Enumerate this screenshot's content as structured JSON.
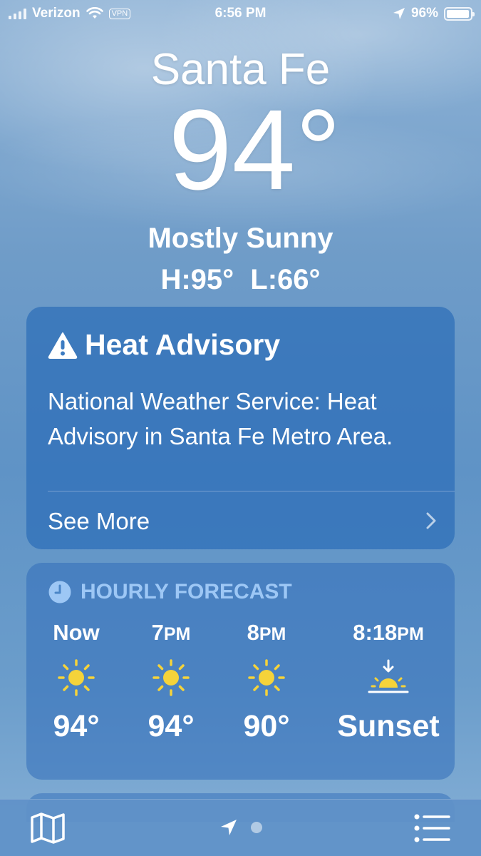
{
  "status_bar": {
    "carrier": "Verizon",
    "vpn": "VPN",
    "time": "6:56 PM",
    "battery": "96%",
    "battery_level": 0.96
  },
  "location": {
    "city": "Santa Fe",
    "temperature": "94°",
    "condition": "Mostly Sunny",
    "high_low": "H:95° L:66°"
  },
  "advisory": {
    "title": "Heat Advisory",
    "body": "National Weather Service: Heat Advisory in Santa Fe Metro Area.",
    "see_more": "See More",
    "icon": "warning-triangle-icon"
  },
  "hourly": {
    "title": "HOURLY FORECAST",
    "icon": "clock-icon",
    "items": [
      {
        "time": "Now",
        "ampm": "",
        "icon": "sun-icon",
        "value": "94°"
      },
      {
        "time": "7",
        "ampm": "PM",
        "icon": "sun-icon",
        "value": "94°"
      },
      {
        "time": "8",
        "ampm": "PM",
        "icon": "sun-icon",
        "value": "90°"
      },
      {
        "time": "8:18",
        "ampm": "PM",
        "icon": "sunset-icon",
        "value": "Sunset"
      }
    ]
  },
  "toolbar": {
    "map_icon": "map-icon",
    "location_icon": "location-arrow-icon",
    "list_icon": "list-icon"
  },
  "colors": {
    "card": "#3a78c0",
    "section_title": "#9dc7f5",
    "sun": "#f5d33a"
  }
}
